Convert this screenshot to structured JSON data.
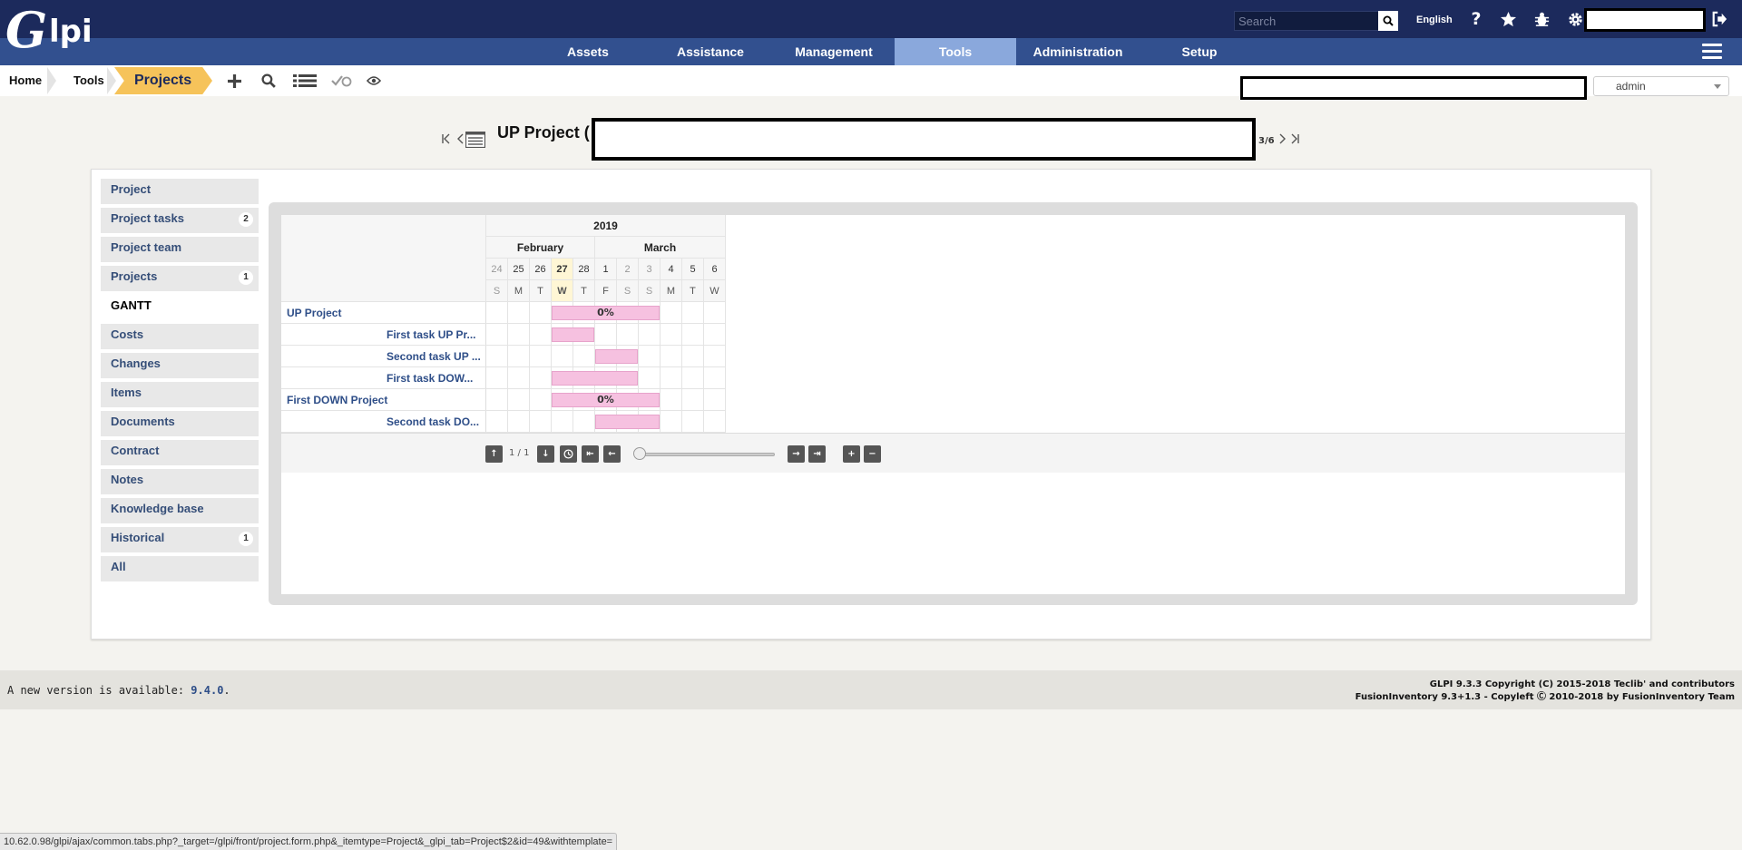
{
  "topbar": {
    "search_placeholder": "Search",
    "language": "English"
  },
  "nav": {
    "items": [
      "Assets",
      "Assistance",
      "Management",
      "Tools",
      "Administration",
      "Setup"
    ],
    "active": "Tools"
  },
  "breadcrumb": {
    "home": "Home",
    "tools": "Tools",
    "current": "Projects"
  },
  "profile": {
    "selected": "admin"
  },
  "title": {
    "text": "UP Project (",
    "pager": "3/6"
  },
  "tabs": [
    {
      "label": "Project",
      "count": ""
    },
    {
      "label": "Project tasks",
      "count": "2"
    },
    {
      "label": "Project team",
      "count": ""
    },
    {
      "label": "Projects",
      "count": "1"
    },
    {
      "label": "GANTT",
      "count": ""
    },
    {
      "label": "Costs",
      "count": ""
    },
    {
      "label": "Changes",
      "count": ""
    },
    {
      "label": "Items",
      "count": ""
    },
    {
      "label": "Documents",
      "count": ""
    },
    {
      "label": "Contract",
      "count": ""
    },
    {
      "label": "Notes",
      "count": ""
    },
    {
      "label": "Knowledge base",
      "count": ""
    },
    {
      "label": "Historical",
      "count": "1"
    },
    {
      "label": "All",
      "count": ""
    }
  ],
  "active_tab": "GANTT",
  "gantt": {
    "year": "2019",
    "months": [
      {
        "name": "February",
        "days": 5
      },
      {
        "name": "March",
        "days": 6
      }
    ],
    "days": [
      "24",
      "25",
      "26",
      "27",
      "28",
      "1",
      "2",
      "3",
      "4",
      "5",
      "6"
    ],
    "weekdays": [
      "S",
      "M",
      "T",
      "W",
      "T",
      "F",
      "S",
      "S",
      "M",
      "T",
      "W"
    ],
    "today_index": 3,
    "weekend_indices": [
      0,
      6,
      7
    ],
    "rows": [
      {
        "label": "UP Project",
        "level": 0,
        "start": 3,
        "span": 5,
        "progress": "0%"
      },
      {
        "label": "First task UP Pr...",
        "level": 1,
        "start": 3,
        "span": 2,
        "progress": ""
      },
      {
        "label": "Second task UP ...",
        "level": 1,
        "start": 5,
        "span": 2,
        "progress": ""
      },
      {
        "label": "First task DOW...",
        "level": 1,
        "start": 3,
        "span": 4,
        "progress": ""
      },
      {
        "label": "First DOWN Project",
        "level": 0,
        "start": 3,
        "span": 5,
        "progress": "0%"
      },
      {
        "label": "Second task DO...",
        "level": 1,
        "start": 5,
        "span": 3,
        "progress": ""
      }
    ],
    "page_indicator": "1 / 1"
  },
  "footer": {
    "version_prefix": "A new version is available: ",
    "version": "9.4.0",
    "version_suffix": ".",
    "copyright_line1": "GLPI 9.3.3 Copyright (C) 2015-2018 Teclib' and contributors",
    "copyright_line2": "FusionInventory 9.3+1.3 - Copyleft Ⓒ 2010-2018 by FusionInventory Team"
  },
  "statusbar": {
    "url": "10.62.0.98/glpi/ajax/common.tabs.php?_target=/glpi/front/project.form.php&_itemtype=Project&_glpi_tab=Project$2&id=49&withtemplate="
  }
}
